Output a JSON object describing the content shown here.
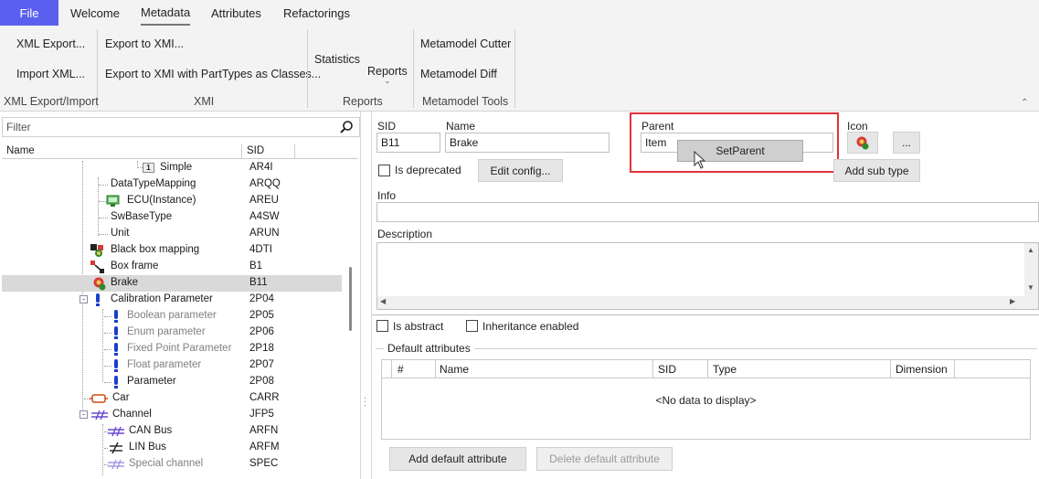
{
  "ribbon": {
    "tabs": [
      "File",
      "Welcome",
      "Metadata",
      "Attributes",
      "Refactorings"
    ],
    "active_tab": "Metadata",
    "buttons": {
      "xml_export": "XML Export...",
      "import_xml": "Import XML...",
      "export_to_xmi": "Export to XMI...",
      "export_to_xmi_parttypes": "Export to XMI with PartTypes as Classes...",
      "statistics": "Statistics",
      "reports": "Reports",
      "metamodel_cutter": "Metamodel Cutter",
      "metamodel_diff": "Metamodel Diff"
    },
    "groups": [
      "XML Export/Import",
      "XMI",
      "Reports",
      "Metamodel Tools"
    ]
  },
  "tree": {
    "filter_placeholder": "Filter",
    "columns": [
      "Name",
      "SID"
    ],
    "rows": [
      {
        "name": "Simple",
        "sid": "AR4I",
        "icon": "simple-type-icon"
      },
      {
        "name": "DataTypeMapping",
        "sid": "ARQQ",
        "icon": "none"
      },
      {
        "name": "ECU(Instance)",
        "sid": "AREU",
        "icon": "ecu-icon"
      },
      {
        "name": "SwBaseType",
        "sid": "A4SW",
        "icon": "none"
      },
      {
        "name": "Unit",
        "sid": "ARUN",
        "icon": "none"
      },
      {
        "name": "Black box mapping",
        "sid": "4DTI",
        "icon": "black-box-mapping-icon"
      },
      {
        "name": "Box frame",
        "sid": "B1",
        "icon": "box-frame-icon"
      },
      {
        "name": "Brake",
        "sid": "B11",
        "icon": "brake-icon"
      },
      {
        "name": "Calibration Parameter",
        "sid": "2P04",
        "icon": "calibration-parameter-icon"
      },
      {
        "name": "Boolean parameter",
        "sid": "2P05",
        "icon": "parameter-icon"
      },
      {
        "name": "Enum parameter",
        "sid": "2P06",
        "icon": "parameter-icon"
      },
      {
        "name": "Fixed Point Parameter",
        "sid": "2P18",
        "icon": "parameter-icon"
      },
      {
        "name": "Float parameter",
        "sid": "2P07",
        "icon": "parameter-icon"
      },
      {
        "name": "Parameter",
        "sid": "2P08",
        "icon": "parameter-icon"
      },
      {
        "name": "Car",
        "sid": "CARR",
        "icon": "car-icon"
      },
      {
        "name": "Channel",
        "sid": "JFP5",
        "icon": "channel-icon"
      },
      {
        "name": "CAN Bus",
        "sid": "ARFN",
        "icon": "can-bus-icon"
      },
      {
        "name": "LIN Bus",
        "sid": "ARFM",
        "icon": "lin-bus-icon"
      },
      {
        "name": "Special channel",
        "sid": "SPEC",
        "icon": "special-channel-icon"
      }
    ]
  },
  "form": {
    "sid_label": "SID",
    "sid_value": "B11",
    "name_label": "Name",
    "name_value": "Brake",
    "parent_label": "Parent",
    "parent_value": "Item",
    "set_parent_popup": "SetParent",
    "icon_label": "Icon",
    "browse_button": "...",
    "add_sub_type_button": "Add sub type",
    "is_deprecated_label": "Is deprecated",
    "edit_config_button": "Edit config...",
    "info_label": "Info",
    "info_value": "",
    "description_label": "Description",
    "description_value": "",
    "is_abstract_label": "Is abstract",
    "inheritance_enabled_label": "Inheritance enabled",
    "default_attributes_label": "Default attributes",
    "grid_columns": [
      "#",
      "Name",
      "SID",
      "Type",
      "Dimension"
    ],
    "grid_empty_text": "<No data to display>",
    "add_default_attribute_button": "Add default attribute",
    "delete_default_attribute_button": "Delete default attribute"
  },
  "colors": {
    "file_tab": "#5b5ff0",
    "highlight_border": "#e0323b",
    "selected_row": "#d9d9d9"
  }
}
